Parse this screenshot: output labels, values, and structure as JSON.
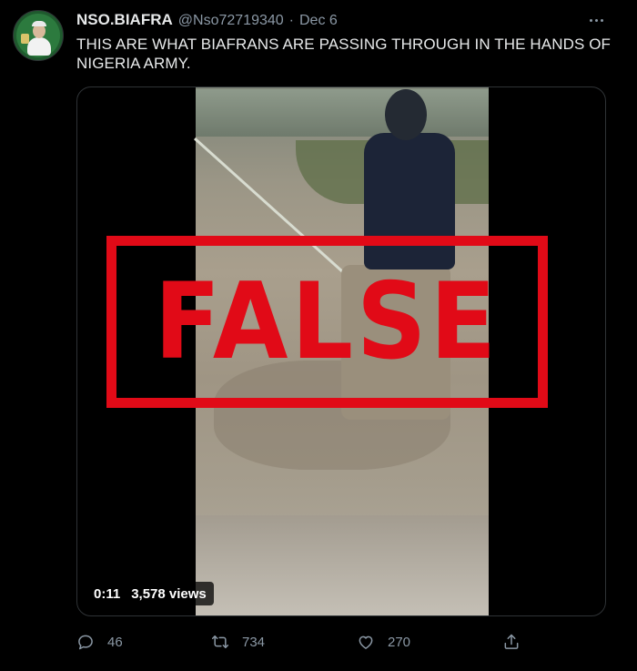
{
  "tweet": {
    "display_name": "NSO.BIAFRA",
    "handle": "@Nso72719340",
    "separator": "·",
    "date": "Dec 6",
    "text": "THIS ARE WHAT BIAFRANS ARE PASSING THROUGH IN THE HANDS OF NIGERIA ARMY."
  },
  "media": {
    "stamp_text": "FALSE",
    "stamp_color": "#e10a17",
    "video_time": "0:11",
    "video_views": "3,578 views"
  },
  "actions": {
    "reply_count": "46",
    "retweet_count": "734",
    "like_count": "270"
  },
  "icons": {
    "more": "more-icon",
    "reply": "reply-icon",
    "retweet": "retweet-icon",
    "like": "like-icon",
    "share": "share-icon"
  }
}
